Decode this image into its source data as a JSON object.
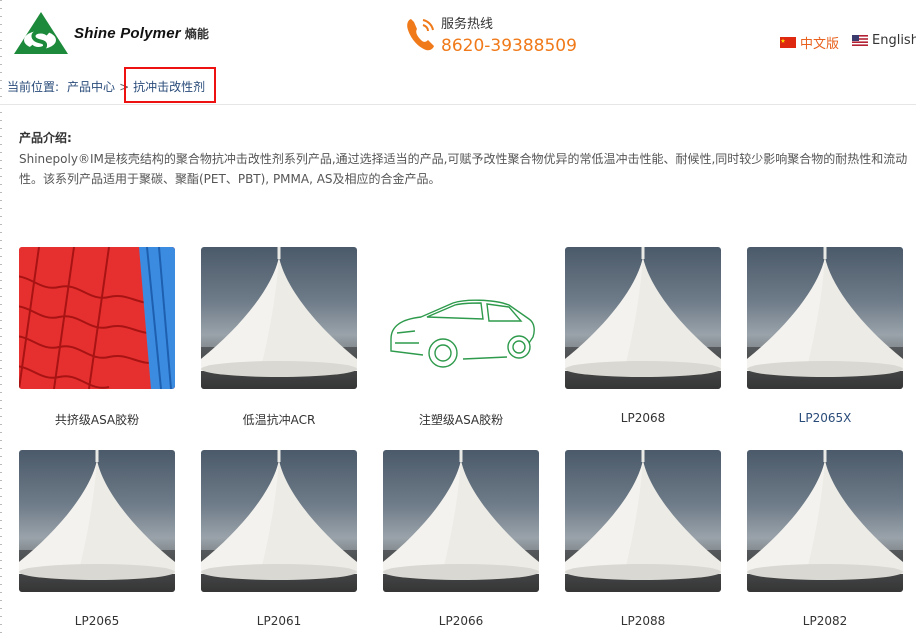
{
  "header": {
    "logo_text": "Shine Polymer",
    "logo_cn": "熵能",
    "hotline_label": "服务热线",
    "hotline_number": "8620-39388509",
    "lang_cn": "中文版",
    "lang_en": "English"
  },
  "breadcrumb": {
    "label": "当前位置:",
    "items": [
      "产品中心",
      "抗冲击改性剂"
    ],
    "separator": ">"
  },
  "intro": {
    "title": "产品介绍:",
    "text": "Shinepoly®IM是核壳结构的聚合物抗冲击改性剂系列产品,通过选择适当的产品,可赋予改性聚合物优异的常低温冲击性能、耐候性,同时较少影响聚合物的耐热性和流动性。该系列产品适用于聚碳、聚酯(PET、PBT), PMMA, AS及相应的合金产品。"
  },
  "products": [
    {
      "name": "共挤级ASA胶粉",
      "image": "roof"
    },
    {
      "name": "低温抗冲ACR",
      "image": "powder"
    },
    {
      "name": "注塑级ASA胶粉",
      "image": "car"
    },
    {
      "name": "LP2068",
      "image": "powder"
    },
    {
      "name": "LP2065X",
      "image": "powder"
    },
    {
      "name": "LP2065",
      "image": "powder"
    },
    {
      "name": "LP2061",
      "image": "powder"
    },
    {
      "name": "LP2066",
      "image": "powder"
    },
    {
      "name": "LP2088",
      "image": "powder"
    },
    {
      "name": "LP2082",
      "image": "powder"
    }
  ],
  "colors": {
    "accent": "#f07a1a",
    "link": "#2a4c7a",
    "highlight": "#ee1111",
    "logo_green": "#1c8a3a"
  }
}
